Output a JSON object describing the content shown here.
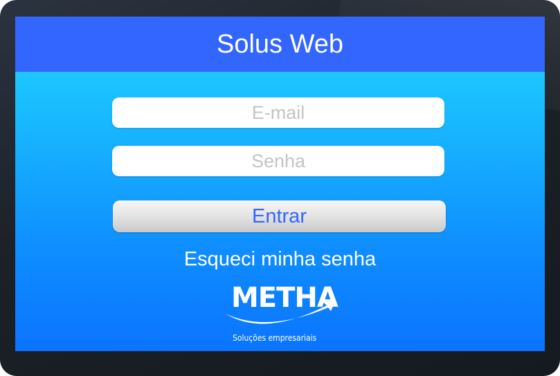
{
  "header": {
    "title": "Solus Web"
  },
  "login": {
    "email_placeholder": "E-mail",
    "password_placeholder": "Senha",
    "submit_label": "Entrar",
    "forgot_label": "Esqueci minha senha"
  },
  "logo": {
    "name": "METHA",
    "tagline": "Soluções empresariais"
  },
  "colors": {
    "header": "#3366ff",
    "screen_gradient_top": "#22d8ff",
    "screen_gradient_bottom": "#0a74ff",
    "button_text": "#3366ff",
    "bezel": "#1c2128"
  }
}
